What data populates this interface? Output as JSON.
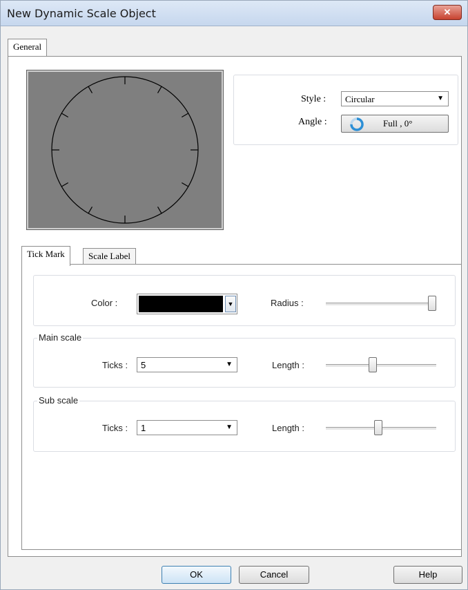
{
  "window": {
    "title": "New Dynamic Scale Object",
    "close_icon": "close-icon"
  },
  "tabs": {
    "general": "General",
    "tick_mark": "Tick Mark",
    "scale_label": "Scale Label"
  },
  "style": {
    "label": "Style :",
    "value": "Circular"
  },
  "angle": {
    "label": "Angle :",
    "value": "Full , 0°"
  },
  "color": {
    "label": "Color :",
    "value": "#000000"
  },
  "radius": {
    "label": "Radius :",
    "level": 1.0
  },
  "main_scale": {
    "title": "Main scale",
    "ticks_label": "Ticks :",
    "ticks_value": "5",
    "length_label": "Length :",
    "length_level": 0.42
  },
  "sub_scale": {
    "title": "Sub scale",
    "ticks_label": "Ticks :",
    "ticks_value": "1",
    "length_label": "Length :",
    "length_level": 0.47
  },
  "preview": {
    "main_ticks": 12,
    "background": "#7f7f7f"
  },
  "buttons": {
    "ok": "OK",
    "cancel": "Cancel",
    "help": "Help"
  },
  "colors": {
    "accent_ok_border": "#3c7fb1",
    "close_red": "#c7422f"
  }
}
